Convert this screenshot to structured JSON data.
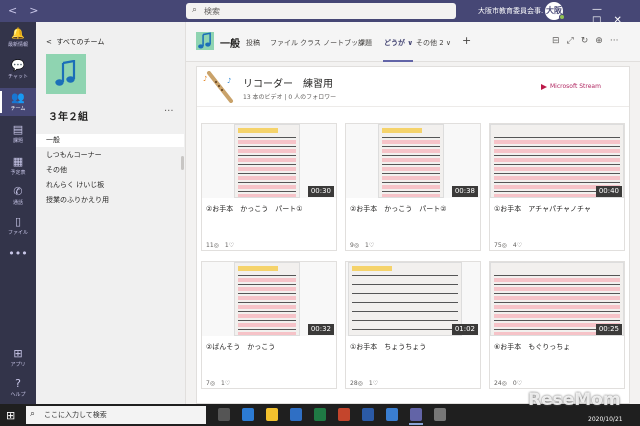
{
  "titlebar": {
    "search_placeholder": "検索",
    "org_name": "大阪市教育委員会事...",
    "avatar_initials": "大阪",
    "back_glyph": "<",
    "forward_glyph": ">",
    "win_min": "—",
    "win_max": "□",
    "win_close": "✕"
  },
  "rail": [
    {
      "label": "最新情報",
      "icon": "bell-icon",
      "glyph": "🔔"
    },
    {
      "label": "チャット",
      "icon": "chat-icon",
      "glyph": "💬"
    },
    {
      "label": "チーム",
      "icon": "teams-icon",
      "glyph": "👥",
      "active": true
    },
    {
      "label": "課題",
      "icon": "assignments-icon",
      "glyph": "▤"
    },
    {
      "label": "予定表",
      "icon": "calendar-icon",
      "glyph": "▦"
    },
    {
      "label": "通話",
      "icon": "phone-icon",
      "glyph": "✆"
    },
    {
      "label": "ファイル",
      "icon": "files-icon",
      "glyph": "▯"
    },
    {
      "label": "",
      "icon": "more-apps-icon",
      "glyph": "•••"
    },
    {
      "label": "アプリ",
      "icon": "apps-icon",
      "glyph": "⊞"
    },
    {
      "label": "ヘルプ",
      "icon": "help-icon",
      "glyph": "?"
    }
  ],
  "sidebar": {
    "back_label": "すべてのチーム",
    "team_name": "３年２組",
    "more": "···",
    "channels": [
      {
        "label": "一般",
        "active": true
      },
      {
        "label": "しつもんコーナー"
      },
      {
        "label": "その他"
      },
      {
        "label": "れんらく けいじ板"
      },
      {
        "label": "授業のふりかえり用"
      }
    ]
  },
  "channel_header": {
    "title": "一般",
    "tabs": [
      {
        "label": "投稿"
      },
      {
        "label": "ファイル"
      },
      {
        "label": "クラス ノートブック"
      },
      {
        "label": "課題"
      },
      {
        "label": "どうが ∨",
        "active": true
      },
      {
        "label": "その他 2 ∨"
      },
      {
        "label": "+"
      }
    ],
    "icons": [
      {
        "name": "conversation-icon",
        "glyph": "⊟"
      },
      {
        "name": "expand-icon",
        "glyph": "⤢"
      },
      {
        "name": "refresh-icon",
        "glyph": "↻"
      },
      {
        "name": "globe-icon",
        "glyph": "⊕"
      },
      {
        "name": "more-options-icon",
        "glyph": "···"
      }
    ]
  },
  "playlist": {
    "title": "リコーダー　練習用",
    "meta": "13 本のビデオ | 0 人のフォロワー",
    "stream_logo": "Microsoft Stream"
  },
  "videos": [
    {
      "title": "②お手本　かっこう　パート①",
      "duration": "00:30",
      "stats": "11◎　1♡"
    },
    {
      "title": "②お手本　かっこう　パート②",
      "duration": "00:38",
      "stats": "9◎　1♡"
    },
    {
      "title": "①お手本　アチャパチャノチャ",
      "duration": "00:40",
      "stats": "75◎　4♡"
    },
    {
      "title": "②ばんそう　かっこう",
      "duration": "00:32",
      "stats": "7◎　1♡"
    },
    {
      "title": "①お手本　ちょうちょう",
      "duration": "01:02",
      "stats": "28◎　1♡"
    },
    {
      "title": "⑥お手本　もぐりっちょ",
      "duration": "00:25",
      "stats": "24◎　0♡"
    }
  ],
  "taskbar": {
    "search_placeholder": "ここに入力して検索",
    "date": "2020/10/21",
    "watermark": "ReseMom"
  },
  "colors": {
    "titlebar": "#464775",
    "rail": "#33344a",
    "accent": "#6264a7",
    "team_tile": "#8fd4b1"
  }
}
